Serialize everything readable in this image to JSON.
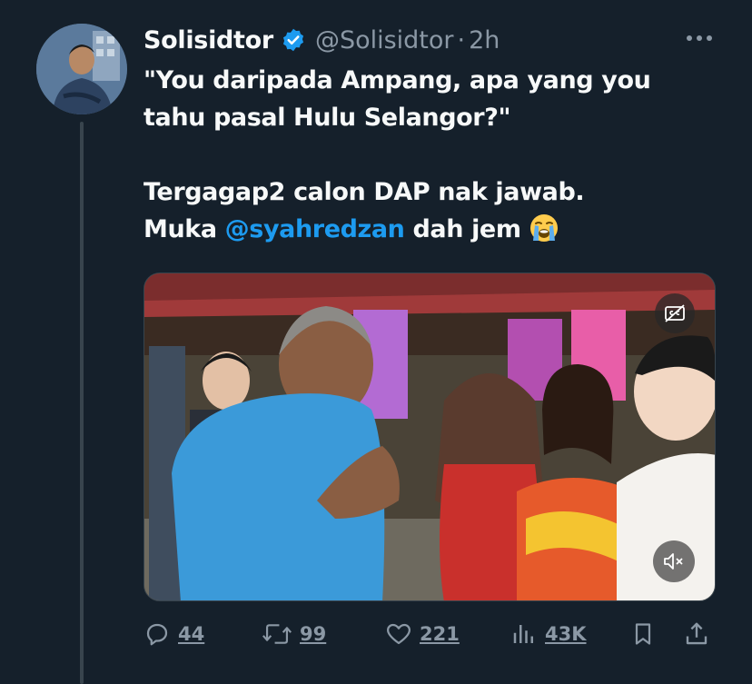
{
  "author": {
    "name": "Solisidtor",
    "handle": "@Solisidtor",
    "separator": "·",
    "time": "2h",
    "avatar_icon": "avatar-photo"
  },
  "tweet": {
    "line1": "\"You daripada Ampang, apa yang you",
    "line2": "tahu pasal Hulu Selangor?\"",
    "line3": "Tergagap2 calon DAP nak jawab.",
    "line4_prefix": "Muka ",
    "mention": "@syahredzan",
    "line4_suffix": " dah jem",
    "emoji_icon": "loudly-crying-face-emoji"
  },
  "media": {
    "type": "video",
    "cc_icon": "closed-captions-off-icon",
    "mute_icon": "speaker-muted-icon"
  },
  "actions": {
    "replies": "44",
    "retweets": "99",
    "likes": "221",
    "views": "43K"
  },
  "colors": {
    "background": "#15202b",
    "text": "#f7f9f9",
    "secondary": "#8b98a5",
    "accent": "#1d9bf0",
    "verified": "#1d9bf0"
  }
}
